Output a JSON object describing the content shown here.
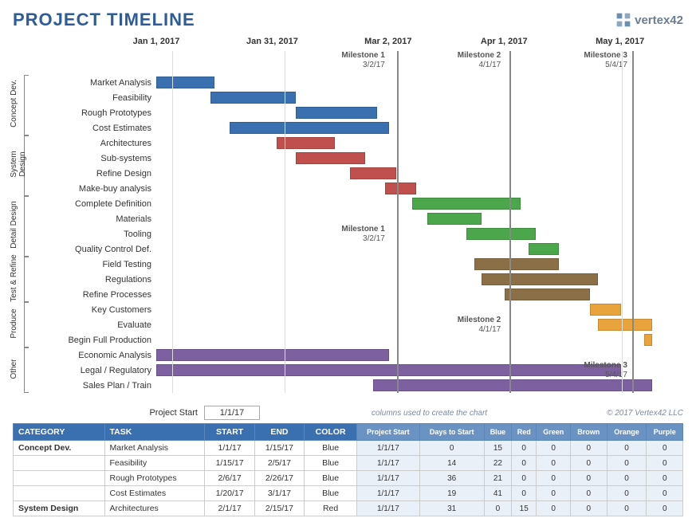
{
  "title": "PROJECT TIMELINE",
  "logo": "vertex42",
  "copyright": "© 2017 Vertex42 LLC",
  "columns_hint": "columns used to create the chart",
  "project_start": {
    "label": "Project Start",
    "value": "1/1/17"
  },
  "chart_data": {
    "type": "gantt",
    "axis_labels": [
      {
        "label": "Jan 1, 2017",
        "pct": 0
      },
      {
        "label": "Jan 31, 2017",
        "pct": 22
      },
      {
        "label": "Mar 2, 2017",
        "pct": 44
      },
      {
        "label": "Apr 1, 2017",
        "pct": 66
      },
      {
        "label": "May 1, 2017",
        "pct": 88
      }
    ],
    "milestones": [
      {
        "name": "Milestone 1",
        "date": "3/2/17",
        "pct": 44
      },
      {
        "name": "Milestone 2",
        "date": "4/1/17",
        "pct": 66
      },
      {
        "name": "Milestone 3",
        "date": "5/4/17",
        "pct": 90
      }
    ],
    "phases": [
      {
        "name": "Concept Dev.",
        "from": 0,
        "to": 3
      },
      {
        "name": "System Design",
        "from": 4,
        "to": 7
      },
      {
        "name": "Detail Design",
        "from": 8,
        "to": 11
      },
      {
        "name": "Test & Refine",
        "from": 12,
        "to": 14
      },
      {
        "name": "Produce",
        "from": 15,
        "to": 17
      },
      {
        "name": "Other",
        "from": 18,
        "to": 20
      }
    ],
    "tasks": [
      {
        "label": "Market Analysis",
        "color": "blue",
        "start": 0,
        "dur": 15
      },
      {
        "label": "Feasibility",
        "color": "blue",
        "start": 14,
        "dur": 22
      },
      {
        "label": "Rough Prototypes",
        "color": "blue",
        "start": 36,
        "dur": 21
      },
      {
        "label": "Cost Estimates",
        "color": "blue",
        "start": 19,
        "dur": 41
      },
      {
        "label": "Architectures",
        "color": "red",
        "start": 31,
        "dur": 15
      },
      {
        "label": "Sub-systems",
        "color": "red",
        "start": 36,
        "dur": 18
      },
      {
        "label": "Refine Design",
        "color": "red",
        "start": 50,
        "dur": 12
      },
      {
        "label": "Make-buy analysis",
        "color": "red",
        "start": 59,
        "dur": 8
      },
      {
        "label": "Complete Definition",
        "color": "green",
        "start": 66,
        "dur": 28
      },
      {
        "label": "Materials",
        "color": "green",
        "start": 70,
        "dur": 14
      },
      {
        "label": "Tooling",
        "color": "green",
        "start": 80,
        "dur": 18
      },
      {
        "label": "Quality Control Def.",
        "color": "green",
        "start": 96,
        "dur": 8
      },
      {
        "label": "Field Testing",
        "color": "brown",
        "start": 82,
        "dur": 22
      },
      {
        "label": "Regulations",
        "color": "brown",
        "start": 84,
        "dur": 30
      },
      {
        "label": "Refine Processes",
        "color": "brown",
        "start": 90,
        "dur": 22
      },
      {
        "label": "Key Customers",
        "color": "orange",
        "start": 112,
        "dur": 8
      },
      {
        "label": "Evaluate",
        "color": "orange",
        "start": 114,
        "dur": 14
      },
      {
        "label": "Begin Full Production",
        "color": "orange",
        "start": 126,
        "dur": 2
      },
      {
        "label": "Economic Analysis",
        "color": "purple",
        "start": 0,
        "dur": 60
      },
      {
        "label": "Legal / Regulatory",
        "color": "purple",
        "start": 0,
        "dur": 120
      },
      {
        "label": "Sales Plan / Train",
        "color": "purple",
        "start": 56,
        "dur": 72
      }
    ],
    "inner_milestone_refs": [
      {
        "row": 10,
        "name": "Milestone 1",
        "date": "3/2/17",
        "pct": 44
      },
      {
        "row": 16,
        "name": "Milestone 2",
        "date": "4/1/17",
        "pct": 66
      },
      {
        "row": 19,
        "name": "Milestone 3",
        "date": "5/4/17",
        "pct": 90
      }
    ],
    "day_span": 136
  },
  "table": {
    "headers": {
      "cat": "CATEGORY",
      "task": "TASK",
      "start": "START",
      "end": "END",
      "color": "COLOR"
    },
    "sub_headers": [
      "Project Start",
      "Days to Start",
      "Blue",
      "Red",
      "Green",
      "Brown",
      "Orange",
      "Purple"
    ],
    "rows": [
      {
        "cat": "Concept Dev.",
        "task": "Market Analysis",
        "start": "1/1/17",
        "end": "1/15/17",
        "color": "Blue",
        "ps": "1/1/17",
        "dts": 0,
        "b": 15,
        "r": 0,
        "g": 0,
        "br": 0,
        "o": 0,
        "p": 0
      },
      {
        "cat": "",
        "task": "Feasibility",
        "start": "1/15/17",
        "end": "2/5/17",
        "color": "Blue",
        "ps": "1/1/17",
        "dts": 14,
        "b": 22,
        "r": 0,
        "g": 0,
        "br": 0,
        "o": 0,
        "p": 0
      },
      {
        "cat": "",
        "task": "Rough Prototypes",
        "start": "2/6/17",
        "end": "2/26/17",
        "color": "Blue",
        "ps": "1/1/17",
        "dts": 36,
        "b": 21,
        "r": 0,
        "g": 0,
        "br": 0,
        "o": 0,
        "p": 0
      },
      {
        "cat": "",
        "task": "Cost Estimates",
        "start": "1/20/17",
        "end": "3/1/17",
        "color": "Blue",
        "ps": "1/1/17",
        "dts": 19,
        "b": 41,
        "r": 0,
        "g": 0,
        "br": 0,
        "o": 0,
        "p": 0
      },
      {
        "cat": "System Design",
        "task": "Architectures",
        "start": "2/1/17",
        "end": "2/15/17",
        "color": "Red",
        "ps": "1/1/17",
        "dts": 31,
        "b": 0,
        "r": 15,
        "g": 0,
        "br": 0,
        "o": 0,
        "p": 0
      }
    ]
  }
}
